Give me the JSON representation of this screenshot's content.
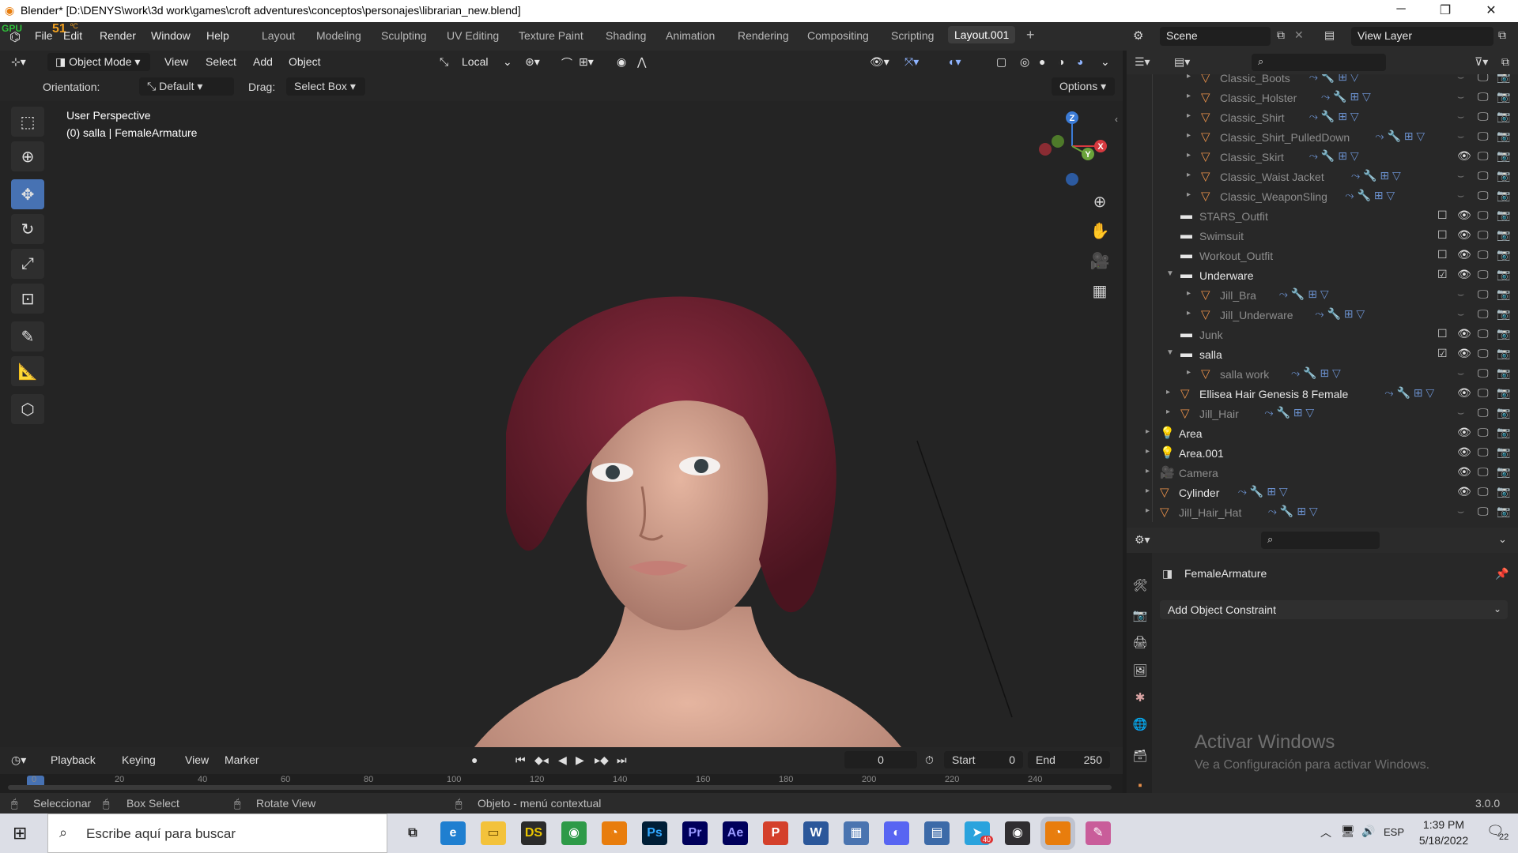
{
  "window": {
    "title": "Blender* [D:\\DENYS\\work\\3d work\\games\\croft adventures\\conceptos\\personajes\\librarian_new.blend]",
    "controls": [
      "minimize-icon",
      "restore-icon",
      "close-icon"
    ]
  },
  "gpu_overlay": {
    "label": "GPU",
    "value": "51",
    "unit": "ºC"
  },
  "menu": {
    "items": [
      "File",
      "Edit",
      "Render",
      "Window",
      "Help"
    ]
  },
  "workspaces": {
    "tabs": [
      "Layout",
      "Modeling",
      "Sculpting",
      "UV Editing",
      "Texture Paint",
      "Shading",
      "Animation",
      "Rendering",
      "Compositing",
      "Scripting",
      "Layout.001"
    ],
    "active": "Layout.001",
    "add_label": "+"
  },
  "top_right": {
    "scene": "Scene",
    "view_layer": "View Layer"
  },
  "viewport_header": {
    "mode": "Object Mode",
    "menus": [
      "View",
      "Select",
      "Add",
      "Object"
    ],
    "transform_pivot": "Local"
  },
  "tool_settings": {
    "orientation_label": "Orientation:",
    "orientation_value": "Default",
    "drag_label": "Drag:",
    "drag_value": "Select Box",
    "options": "Options"
  },
  "viewport": {
    "perspective": "User Perspective",
    "object_info": "(0) salla | FemaleArmature",
    "gizmo_axes": [
      "Z",
      "X",
      "Y"
    ]
  },
  "outliner": {
    "rows": [
      {
        "name": "Classic_Boots",
        "depth": 3,
        "type": "mesh",
        "dim": true,
        "visible": false
      },
      {
        "name": "Classic_Holster",
        "depth": 3,
        "type": "mesh",
        "dim": true,
        "visible": false
      },
      {
        "name": "Classic_Shirt",
        "depth": 3,
        "type": "mesh",
        "dim": true,
        "visible": false
      },
      {
        "name": "Classic_Shirt_PulledDown",
        "depth": 3,
        "type": "mesh",
        "dim": true,
        "visible": false
      },
      {
        "name": "Classic_Skirt",
        "depth": 3,
        "type": "mesh",
        "dim": true,
        "visible": true
      },
      {
        "name": "Classic_Waist Jacket",
        "depth": 3,
        "type": "mesh",
        "dim": true,
        "visible": false
      },
      {
        "name": "Classic_WeaponSling",
        "depth": 3,
        "type": "mesh",
        "dim": true,
        "visible": false
      },
      {
        "name": "STARS_Outfit",
        "depth": 2,
        "type": "collection",
        "dim": true,
        "visible": true,
        "checkbox": false
      },
      {
        "name": "Swimsuit",
        "depth": 2,
        "type": "collection",
        "dim": true,
        "visible": true,
        "checkbox": false
      },
      {
        "name": "Workout_Outfit",
        "depth": 2,
        "type": "collection",
        "dim": true,
        "visible": true,
        "checkbox": false
      },
      {
        "name": "Underware",
        "depth": 2,
        "type": "collection",
        "dim": false,
        "expanded": true,
        "visible": true,
        "checkbox": true
      },
      {
        "name": "Jill_Bra",
        "depth": 3,
        "type": "mesh",
        "dim": true,
        "visible": false
      },
      {
        "name": "Jill_Underware",
        "depth": 3,
        "type": "mesh",
        "dim": true,
        "visible": false
      },
      {
        "name": "Junk",
        "depth": 2,
        "type": "collection",
        "dim": true,
        "visible": true,
        "checkbox": false
      },
      {
        "name": "salla",
        "depth": 2,
        "type": "collection",
        "dim": false,
        "expanded": true,
        "visible": true,
        "checkbox": true
      },
      {
        "name": "salla work",
        "depth": 3,
        "type": "mesh",
        "dim": true,
        "visible": false
      },
      {
        "name": "Ellisea Hair Genesis 8 Female",
        "depth": 2,
        "type": "mesh",
        "dim": false,
        "visible": true
      },
      {
        "name": "Jill_Hair",
        "depth": 2,
        "type": "mesh",
        "dim": true,
        "visible": false
      },
      {
        "name": "Area",
        "depth": 1,
        "type": "light",
        "dim": false,
        "visible": true
      },
      {
        "name": "Area.001",
        "depth": 1,
        "type": "light",
        "dim": false,
        "visible": true
      },
      {
        "name": "Camera",
        "depth": 1,
        "type": "camera",
        "dim": true,
        "visible": true
      },
      {
        "name": "Cylinder",
        "depth": 1,
        "type": "mesh",
        "dim": false,
        "visible": true
      },
      {
        "name": "Jill_Hair_Hat",
        "depth": 1,
        "type": "mesh",
        "dim": true,
        "visible": false
      }
    ]
  },
  "properties": {
    "object_name": "FemaleArmature",
    "add_constraint": "Add Object Constraint"
  },
  "watermark": {
    "title": "Activar Windows",
    "subtitle": "Ve a Configuración para activar Windows."
  },
  "timeline": {
    "menus": [
      "Playback",
      "Keying",
      "View",
      "Marker"
    ],
    "current_frame": "0",
    "start_label": "Start",
    "start_value": "0",
    "end_label": "End",
    "end_value": "250",
    "ruler_ticks": [
      "0",
      "20",
      "40",
      "60",
      "80",
      "100",
      "120",
      "140",
      "160",
      "180",
      "200",
      "220",
      "240"
    ]
  },
  "statusbar": {
    "select": "Seleccionar",
    "box_select": "Box Select",
    "rotate": "Rotate View",
    "context": "Objeto - menú contextual",
    "version": "3.0.0"
  },
  "taskbar": {
    "search_placeholder": "Escribe aquí para buscar",
    "apps": [
      "task-view",
      "edge",
      "explorer",
      "daz-studio",
      "chrome",
      "blender",
      "photoshop",
      "premiere",
      "after-effects",
      "pdf",
      "word",
      "calculator",
      "discord",
      "remote-desktop",
      "telegram",
      "obs",
      "blender-active",
      "paint"
    ],
    "telegram_badge": "40",
    "language": "ESP",
    "time": "1:39 PM",
    "date": "5/18/2022",
    "notifications": "22"
  },
  "colors": {
    "accent": "#4772b3",
    "active_tab_bg": "#3d3d3d",
    "hair": "#7a2535",
    "skin": "#d9a68f",
    "mesh_icon": "#e8904a"
  }
}
